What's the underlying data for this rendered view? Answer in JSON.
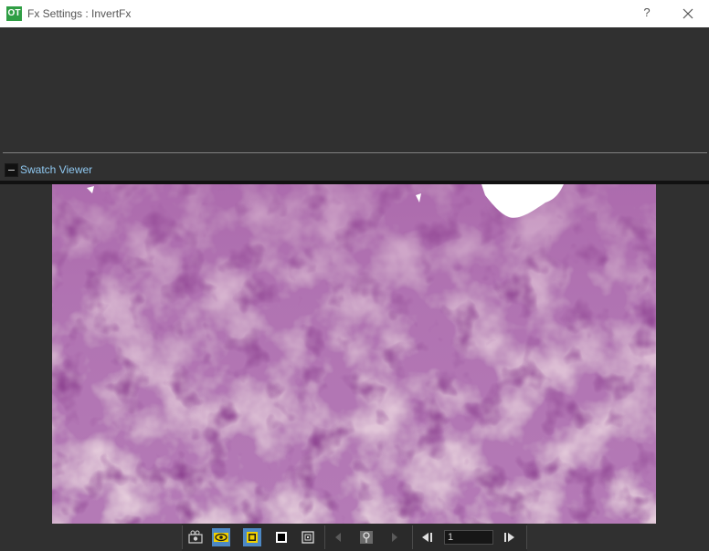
{
  "window": {
    "title": "Fx Settings : InvertFx",
    "logo_text": "OT",
    "help_label": "?"
  },
  "section": {
    "label": "Swatch Viewer"
  },
  "toolbar": {
    "frame_value": "1",
    "icons": [
      "camera-icon",
      "eye-icon",
      "checkerboard-icon",
      "black-bg-icon",
      "white-bg-icon",
      "prev-frame-icon",
      "pin-icon",
      "next-frame-icon",
      "first-frame-icon",
      "last-frame-icon"
    ]
  },
  "colors": {
    "accent": "#4d88c4",
    "highlight": "#f0d000",
    "link": "#8fc8f0",
    "panel": "#303030"
  }
}
